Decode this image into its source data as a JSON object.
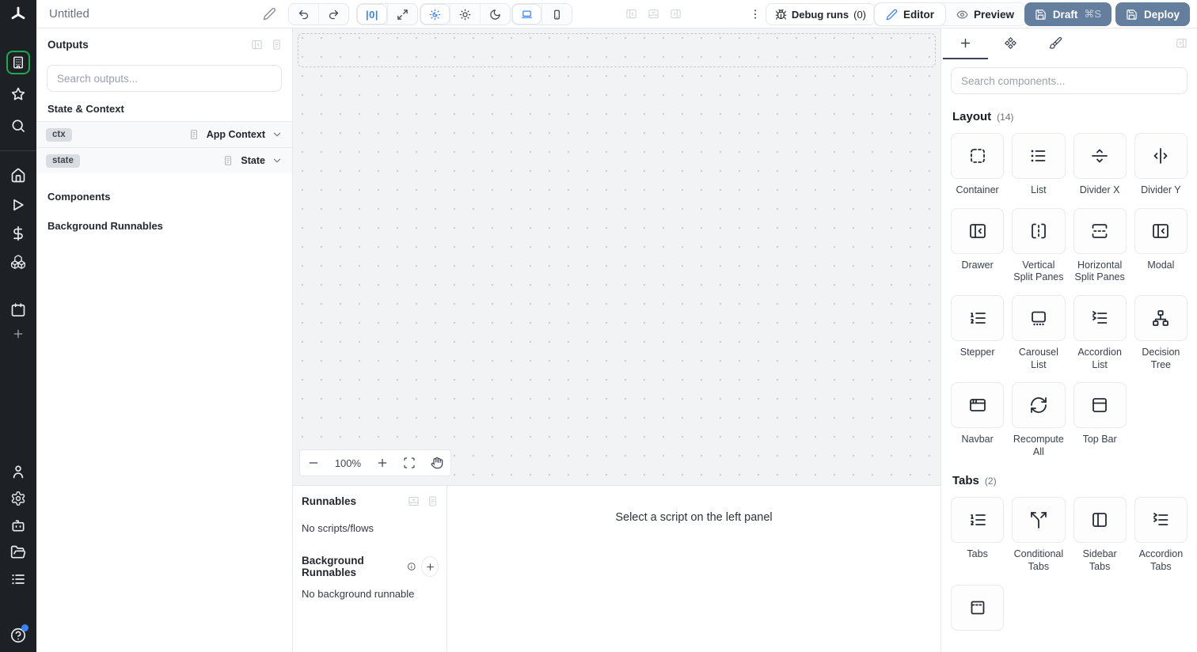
{
  "topbar": {
    "title": "Untitled",
    "zoom_reset": "|0|",
    "debug_runs": "Debug runs",
    "debug_count": "(0)",
    "editor": "Editor",
    "preview": "Preview",
    "draft": "Draft",
    "draft_shortcut": "⌘S",
    "deploy": "Deploy"
  },
  "outputs": {
    "title": "Outputs",
    "search_placeholder": "Search outputs...",
    "state_context_header": "State & Context",
    "rows": [
      {
        "badge": "ctx",
        "type": "App Context"
      },
      {
        "badge": "state",
        "type": "State"
      }
    ],
    "components_header": "Components",
    "background_header": "Background Runnables"
  },
  "canvas": {
    "zoom_level": "100%"
  },
  "bottom_panel": {
    "runnables_title": "Runnables",
    "no_scripts": "No scripts/flows",
    "background_title": "Background Runnables",
    "no_background": "No background runnable",
    "select_hint": "Select a script on the left panel"
  },
  "components_panel": {
    "search_placeholder": "Search components...",
    "layout_title": "Layout",
    "layout_count": "(14)",
    "layout_items": [
      "Container",
      "List",
      "Divider X",
      "Divider Y",
      "Drawer",
      "Vertical Split Panes",
      "Horizontal Split Panes",
      "Modal",
      "Stepper",
      "Carousel List",
      "Accordion List",
      "Decision Tree",
      "Navbar",
      "Recompute All",
      "Top Bar"
    ],
    "tabs_title": "Tabs",
    "tabs_count": "(2)",
    "tabs_items": [
      "Tabs",
      "Conditional Tabs",
      "Sidebar Tabs",
      "Accordion Tabs"
    ]
  },
  "colors": {
    "accent_blue": "#3b82f6",
    "deploy_button": "#647e9e",
    "active_green": "#1fa84c",
    "sidebar_bg": "#1d2126"
  }
}
